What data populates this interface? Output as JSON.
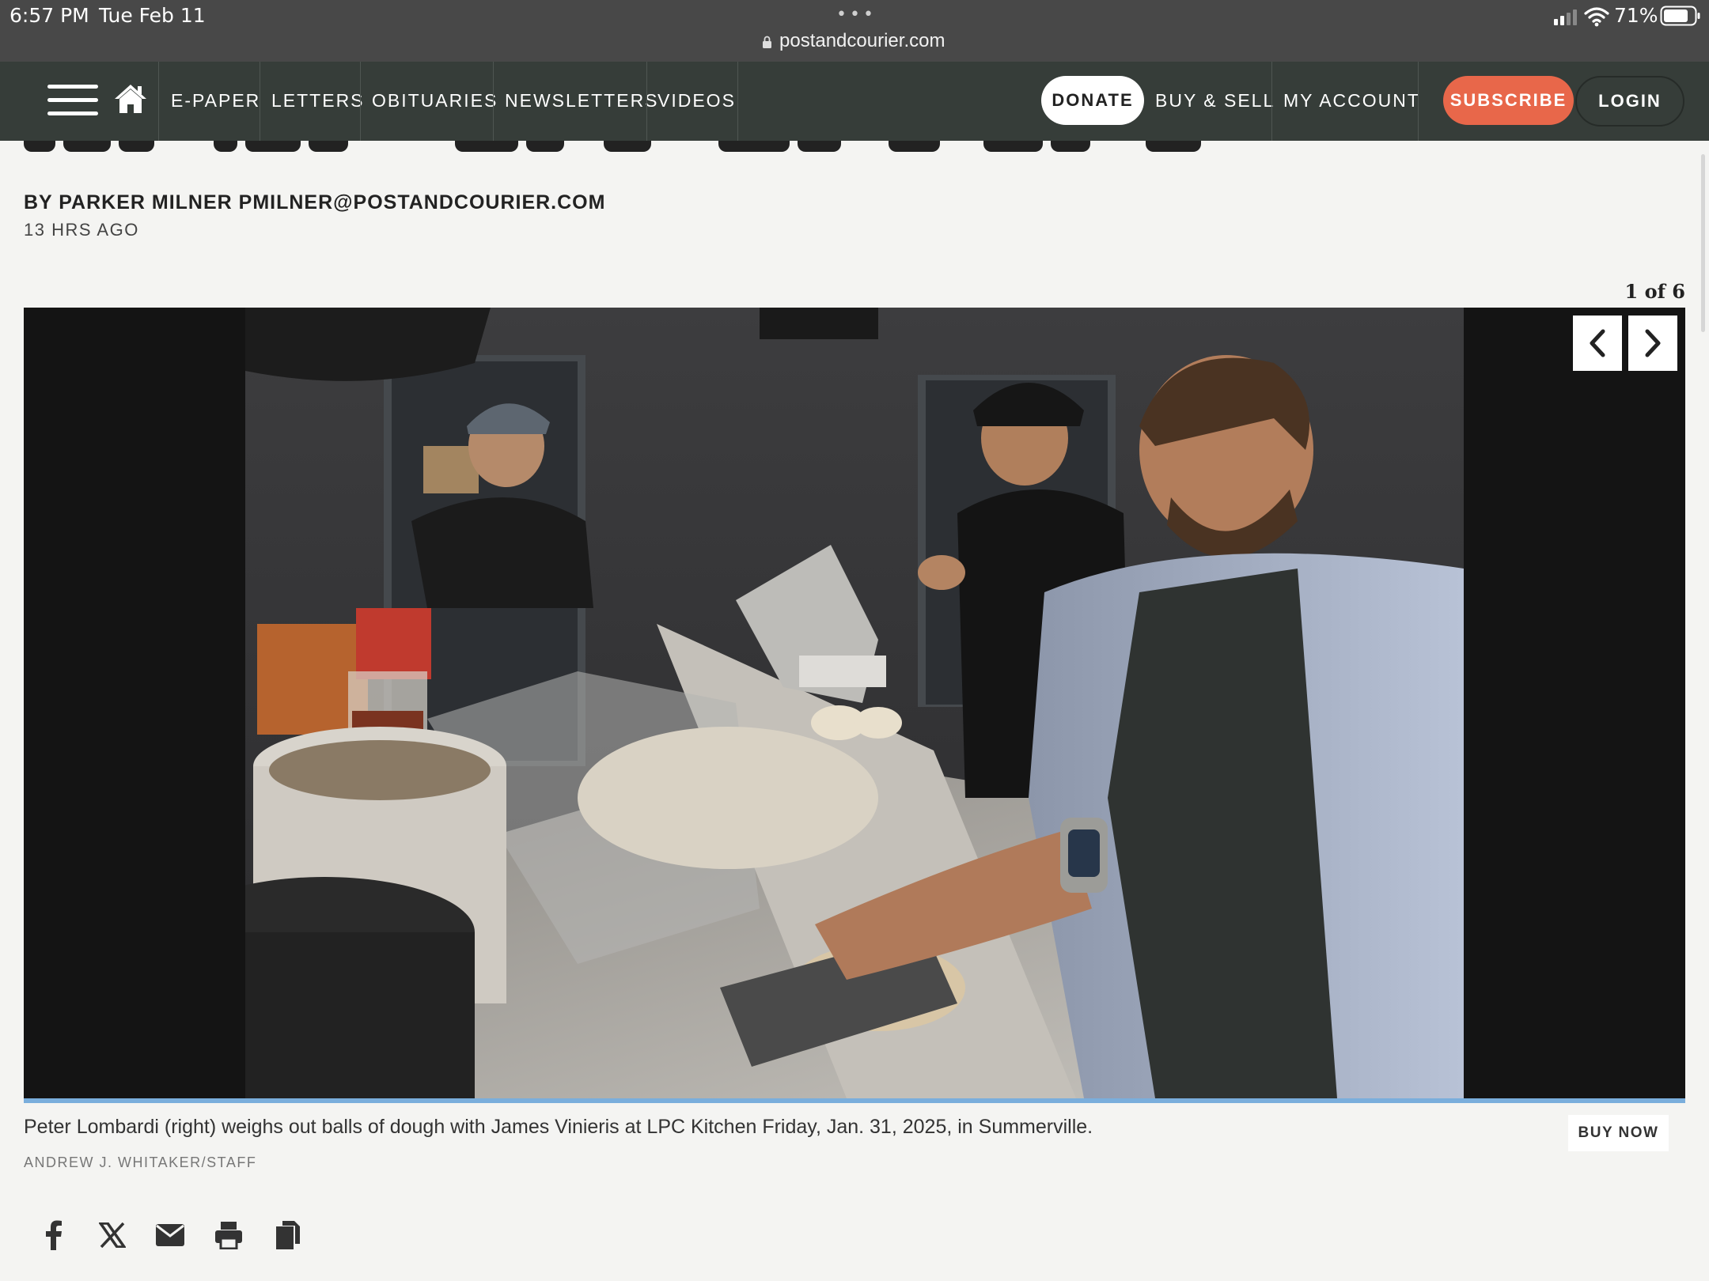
{
  "status_bar": {
    "time": "6:57 PM",
    "date": "Tue Feb 11",
    "url": "postandcourier.com",
    "battery": "71%"
  },
  "nav": {
    "links": [
      "E-PAPER",
      "LETTERS",
      "OBITUARIES",
      "NEWSLETTERS",
      "VIDEOS"
    ],
    "donate": "DONATE",
    "right_links": [
      "BUY & SELL",
      "MY ACCOUNT"
    ],
    "subscribe": "SUBSCRIBE",
    "login": "LOGIN",
    "accent_color": "#e8674a",
    "bar_color": "#363d39"
  },
  "article": {
    "byline": "BY PARKER MILNER PMILNER@POSTANDCOURIER.COM",
    "timestamp": "13 HRS AGO"
  },
  "gallery": {
    "counter": "1 of 6",
    "progress": 0.1667,
    "caption": "Peter Lombardi (right) weighs out balls of dough with James Vinieris at LPC Kitchen Friday, Jan. 31, 2025, in Summerville.",
    "credit": "ANDREW J. WHITAKER/STAFF",
    "buy_now": "BUY NOW"
  },
  "share": {
    "icons": [
      "facebook-icon",
      "x-icon",
      "email-icon",
      "print-icon",
      "copy-icon"
    ]
  }
}
